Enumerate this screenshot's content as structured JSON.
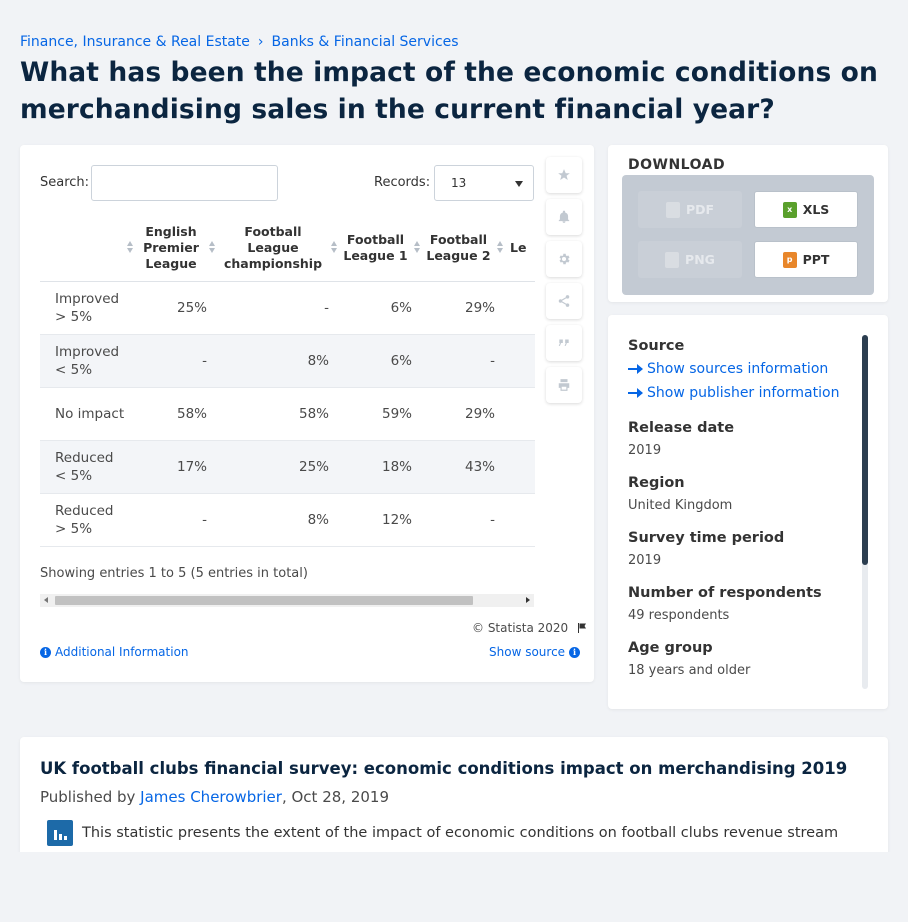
{
  "breadcrumb": {
    "item1": "Finance, Insurance & Real Estate",
    "sep": "›",
    "item2": "Banks & Financial Services"
  },
  "title": "What has been the impact of the economic conditions on merchandising sales in the current financial year?",
  "controls": {
    "search_label": "Search:",
    "records_label": "Records:",
    "records_value": "13"
  },
  "table": {
    "columns": [
      "",
      "English Premier League",
      "Football League championship",
      "Football League 1",
      "Football League 2",
      "Le"
    ],
    "rows": [
      {
        "label": "Improved > 5%",
        "values": [
          "25%",
          "-",
          "6%",
          "29%",
          ""
        ]
      },
      {
        "label": "Improved < 5%",
        "values": [
          "-",
          "8%",
          "6%",
          "-",
          ""
        ]
      },
      {
        "label": "No impact",
        "values": [
          "58%",
          "58%",
          "59%",
          "29%",
          ""
        ]
      },
      {
        "label": "Reduced < 5%",
        "values": [
          "17%",
          "25%",
          "18%",
          "43%",
          ""
        ]
      },
      {
        "label": "Reduced > 5%",
        "values": [
          "-",
          "8%",
          "12%",
          "-",
          ""
        ]
      }
    ]
  },
  "showing": "Showing entries 1 to 5 (5 entries in total)",
  "copyright": "© Statista 2020",
  "additional_info": "Additional Information",
  "show_source": "Show source",
  "download": {
    "title": "DOWNLOAD",
    "pdf": "PDF",
    "xls": "XLS",
    "png": "PNG",
    "ppt": "PPT"
  },
  "source": {
    "source_heading": "Source",
    "show_sources": "Show sources information",
    "show_publisher": "Show publisher information",
    "release_label": "Release date",
    "release_value": "2019",
    "region_label": "Region",
    "region_value": "United Kingdom",
    "survey_label": "Survey time period",
    "survey_value": "2019",
    "respondents_label": "Number of respondents",
    "respondents_value": "49 respondents",
    "age_label": "Age group",
    "age_value": "18 years and older"
  },
  "info": {
    "title": "UK football clubs financial survey: economic conditions impact on merchandising 2019",
    "published_prefix": "Published by",
    "author": "James Cherowbrier",
    "date": ", Oct 28, 2019",
    "description": "This statistic presents the extent of the impact of economic conditions on football clubs revenue stream"
  },
  "colors": {
    "link": "#0666e5",
    "title": "#0b2540",
    "xls": "#5aa02c",
    "ppt": "#e8862a"
  }
}
